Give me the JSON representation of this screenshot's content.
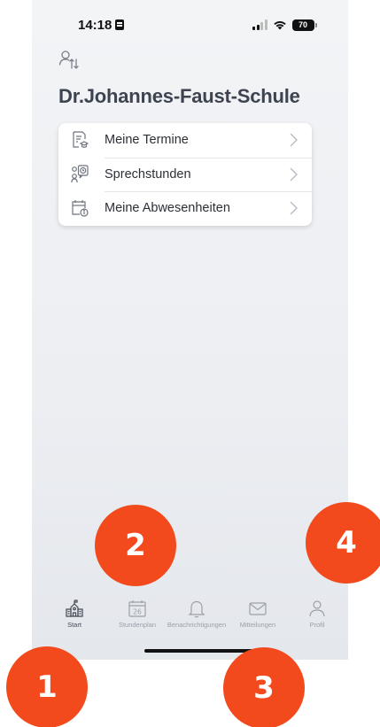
{
  "status_bar": {
    "time": "14:18",
    "battery": "70"
  },
  "header": {
    "school_name": "Dr.Johannes-Faust-Schule"
  },
  "menu": {
    "items": [
      {
        "label": "Meine Termine",
        "icon": "appointments-icon"
      },
      {
        "label": "Sprechstunden",
        "icon": "consultation-hours-icon"
      },
      {
        "label": "Meine Abwesenheiten",
        "icon": "absences-icon"
      }
    ]
  },
  "tabbar": {
    "active": "Start",
    "tabs": [
      {
        "label": "Start",
        "icon": "school-icon"
      },
      {
        "label": "Stundenplan",
        "icon": "calendar-icon",
        "icon_text": "26"
      },
      {
        "label": "Benachrichtigungen",
        "icon": "bell-icon"
      },
      {
        "label": "Mitteilungen",
        "icon": "envelope-icon"
      },
      {
        "label": "Profil",
        "icon": "person-icon"
      }
    ]
  },
  "step_badges": [
    "1",
    "2",
    "3",
    "4"
  ],
  "colors": {
    "badge": "#f24a1c",
    "title": "#3d4450",
    "inactive_tab": "#9ba0a8"
  }
}
